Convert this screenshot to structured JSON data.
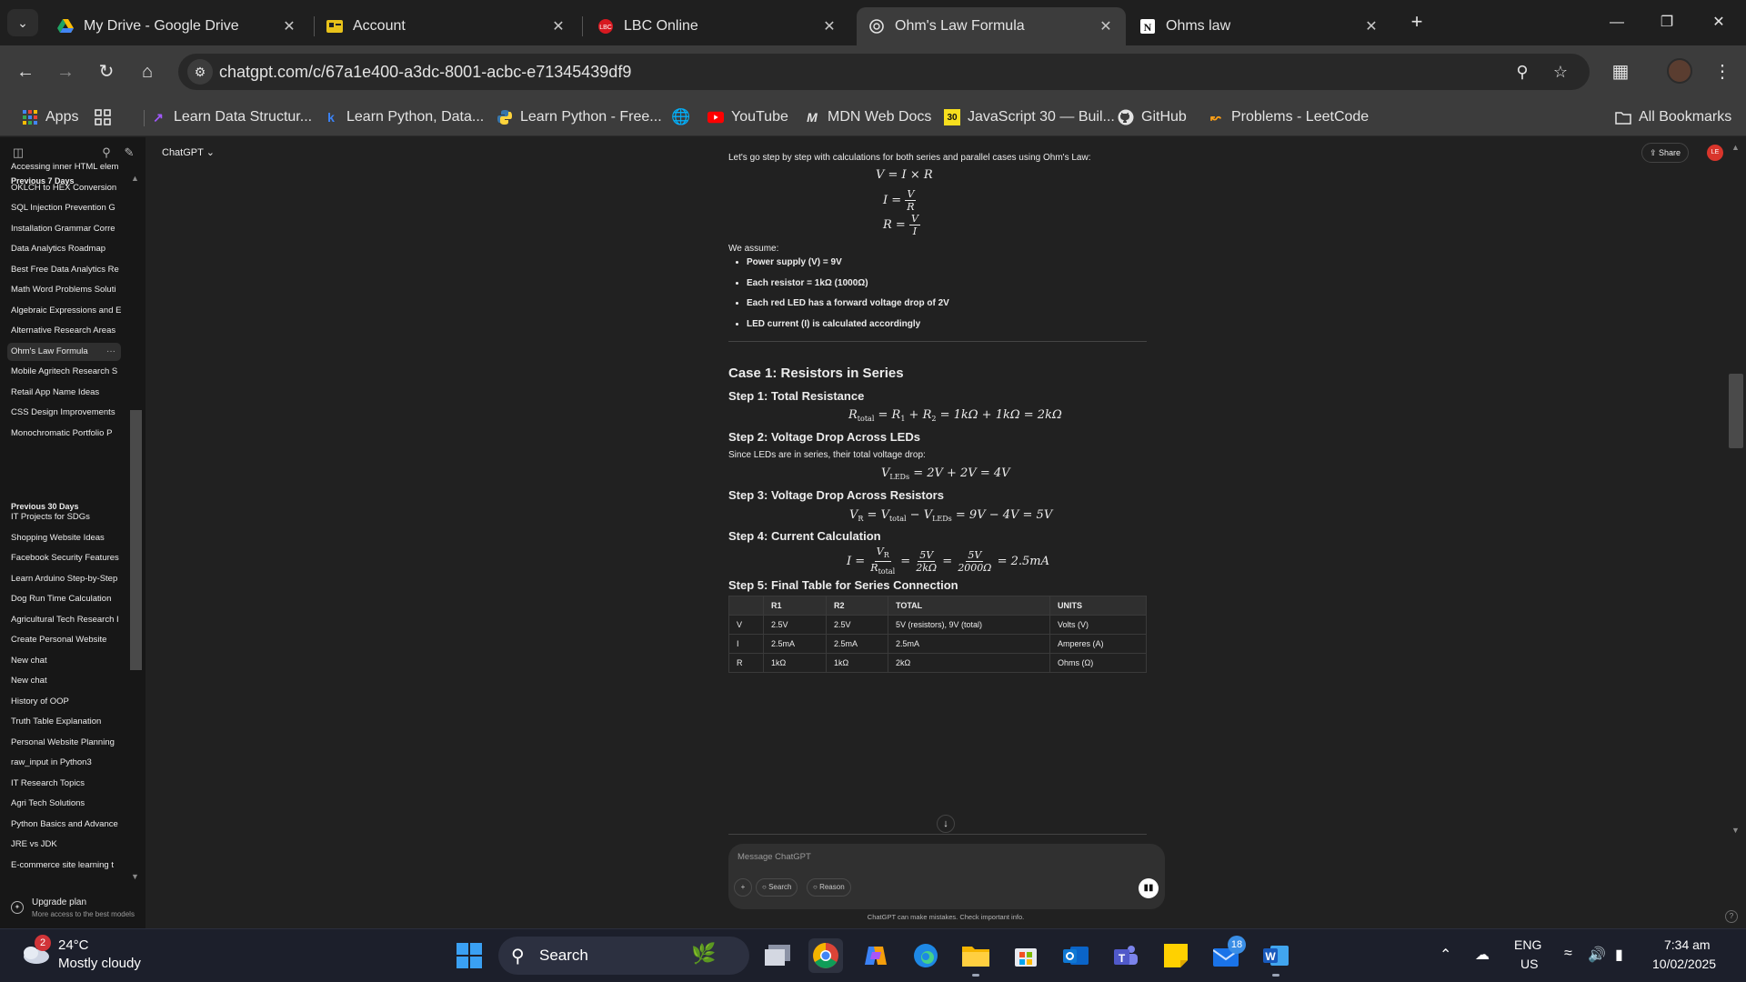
{
  "browser": {
    "tabs": [
      {
        "title": "My Drive - Google Drive",
        "icon": "google-drive-icon"
      },
      {
        "title": "Account",
        "icon": "account-icon"
      },
      {
        "title": "LBC Online",
        "icon": "lbc-icon"
      },
      {
        "title": "Ohm's Law Formula",
        "icon": "chatgpt-icon",
        "active": true
      },
      {
        "title": "Ohms law",
        "icon": "notion-icon"
      }
    ],
    "url": "chatgpt.com/c/67a1e400-a3dc-8001-acbc-e71345439df9",
    "bookmarks": [
      {
        "label": "Apps",
        "icon": "apps-grid-icon"
      },
      {
        "label": "",
        "icon": "tab-groups-icon"
      },
      {
        "label": "Learn Data Structur...",
        "icon": "dsa-icon"
      },
      {
        "label": "Learn Python, Data...",
        "icon": "k-icon"
      },
      {
        "label": "Learn Python - Free...",
        "icon": "python-icon"
      },
      {
        "label": "",
        "icon": "globe-icon"
      },
      {
        "label": "YouTube",
        "icon": "youtube-icon"
      },
      {
        "label": "MDN Web Docs",
        "icon": "mdn-icon"
      },
      {
        "label": "JavaScript 30 — Buil...",
        "icon": "js30-icon"
      },
      {
        "label": "GitHub",
        "icon": "github-icon"
      },
      {
        "label": "Problems - LeetCode",
        "icon": "leetcode-icon"
      }
    ],
    "all_bookmarks": "All Bookmarks"
  },
  "sidebar": {
    "group_7": "Previous 7 Days",
    "items_7": [
      "Accessing inner HTML elem",
      "OKLCH to HEX Conversion",
      "SQL Injection Prevention G",
      "Installation Grammar Corre",
      "Data Analytics Roadmap",
      "Best Free Data Analytics Re",
      "Math Word Problems Soluti",
      "Algebraic Expressions and E",
      "Alternative Research Areas",
      "Ohm's Law Formula",
      "Mobile Agritech Research S",
      "Retail App Name Ideas",
      "CSS Design Improvements",
      "Monochromatic Portfolio P"
    ],
    "group_30": "Previous 30 Days",
    "items_30": [
      "IT Projects for SDGs",
      "Shopping Website Ideas",
      "Facebook Security Features",
      "Learn Arduino Step-by-Step",
      "Dog Run Time Calculation",
      "Agricultural Tech Research I",
      "Create Personal Website",
      "New chat",
      "New chat",
      "History of OOP",
      "Truth Table Explanation",
      "Personal Website Planning",
      "raw_input in Python3",
      "IT Research Topics",
      "Agri Tech Solutions",
      "Python Basics and Advance",
      "JRE vs JDK",
      "E-commerce site learning t"
    ],
    "upgrade_title": "Upgrade plan",
    "upgrade_sub": "More access to the best models"
  },
  "header": {
    "model": "ChatGPT",
    "share": "Share",
    "avatar_initials": "LE"
  },
  "chat": {
    "intro": "Let's go step by step with calculations for both series and parallel cases using Ohm's Law:",
    "assume": "We assume:",
    "bullets": [
      "Power supply (V) = 9V",
      "Each resistor = 1kΩ (1000Ω)",
      "Each red LED has a forward voltage drop of 2V",
      "LED current (I) is calculated accordingly"
    ],
    "case1": "Case 1: Resistors in Series",
    "step1": "Step 1: Total Resistance",
    "step2": "Step 2: Voltage Drop Across LEDs",
    "step2_text": "Since LEDs are in series, their total voltage drop:",
    "step3": "Step 3: Voltage Drop Across Resistors",
    "step4": "Step 4: Current Calculation",
    "step5": "Step 5: Final Table for Series Connection",
    "table": {
      "headers": [
        "",
        "R1",
        "R2",
        "TOTAL",
        "UNITS"
      ],
      "rows": [
        [
          "V",
          "2.5V",
          "2.5V",
          "5V (resistors), 9V (total)",
          "Volts (V)"
        ],
        [
          "I",
          "2.5mA",
          "2.5mA",
          "2.5mA",
          "Amperes (A)"
        ],
        [
          "R",
          "1kΩ",
          "1kΩ",
          "2kΩ",
          "Ohms (Ω)"
        ]
      ]
    }
  },
  "composer": {
    "placeholder": "Message ChatGPT",
    "search": "Search",
    "reason": "Reason",
    "disclaimer": "ChatGPT can make mistakes. Check important info."
  },
  "taskbar": {
    "weather_temp": "24°C",
    "weather_desc": "Mostly cloudy",
    "weather_badge": "2",
    "search": "Search",
    "teams_badge": "18",
    "lang": "ENG",
    "region": "US",
    "time": "7:34 am",
    "date": "10/02/2025"
  },
  "colors": {
    "chat_bg": "#212121",
    "sidebar_bg": "#171717",
    "chrome_bg": "#3c3c3c",
    "taskbar_bg": "#1c1f2b"
  }
}
